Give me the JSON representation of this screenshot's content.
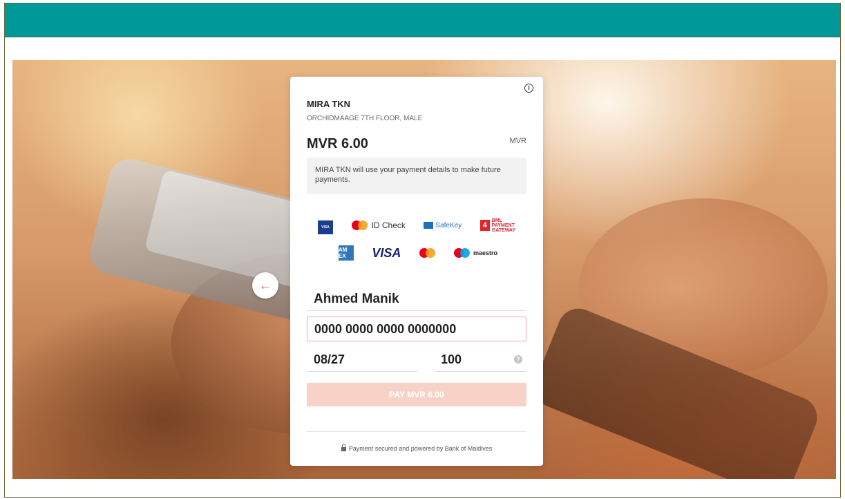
{
  "merchant": {
    "name": "MIRA TKN",
    "address": "ORCHIDMAAGE 7TH FLOOR, MALE"
  },
  "payment": {
    "amount": "MVR 6.00",
    "currency": "MVR",
    "notice": "MIRA TKN will use your payment details to make future payments."
  },
  "logos": {
    "id_check": "ID Check",
    "safekey": "SafeKey",
    "bml_line1": "BML",
    "bml_line2": "PAYMENT",
    "bml_line3": "GATEWAY",
    "visa": "VISA",
    "maestro": "maestro",
    "visa_secure": "VISA",
    "amex": "AM EX"
  },
  "form": {
    "cardholder_name": "Ahmed Manik",
    "card_number": "0000 0000 0000 0000000",
    "expiry": "08/27",
    "cvv": "100",
    "help_glyph": "?"
  },
  "actions": {
    "pay_label": "PAY MVR 6.00",
    "back_glyph": "←",
    "info_glyph": "i"
  },
  "footer": {
    "text": "Payment secured and powered by Bank of Maldives"
  },
  "colors": {
    "topbar": "#009999",
    "pay_button": "#f9d2c7",
    "card_border_error": "#f2a9a6",
    "back_arrow": "#e05a4a"
  }
}
